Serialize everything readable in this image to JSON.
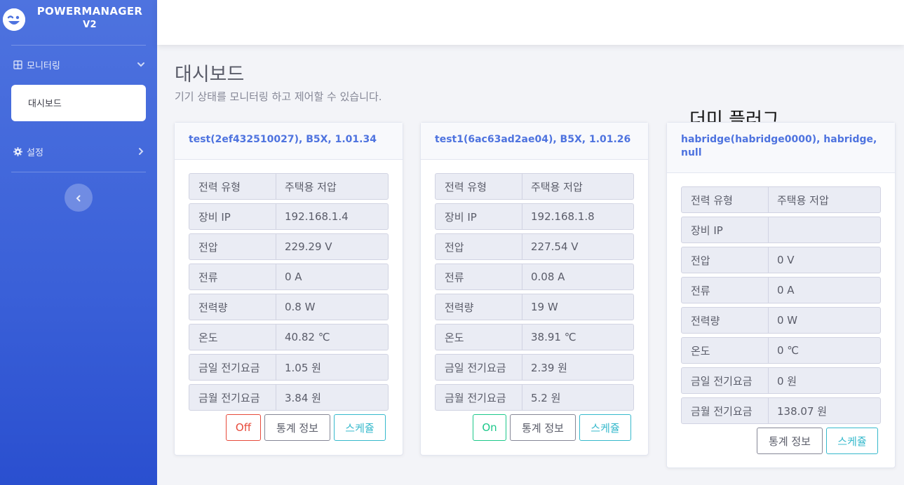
{
  "brand": {
    "name_line1": "POWERMANAGER",
    "name_line2": "V2"
  },
  "sidebar": {
    "menu_monitoring": "모니터링",
    "submenu_dashboard": "대시보드",
    "menu_settings": "설정"
  },
  "page": {
    "title": "대시보드",
    "subtitle": "기기 상태를 모니터링 하고 제어할 수 있습니다.",
    "dummy_label": "더미 플러그"
  },
  "labels": {
    "power_type": "전력 유형",
    "device_ip": "장비 IP",
    "voltage": "전압",
    "current": "전류",
    "power": "전력량",
    "temperature": "온도",
    "today_fee": "금일 전기요금",
    "month_fee": "금월 전기요금",
    "btn_stats": "통계 정보",
    "btn_schedule": "스케쥴"
  },
  "devices": [
    {
      "header": "test(2ef432510027), B5X, 1.01.34",
      "power_type": "주택용 저압",
      "device_ip": "192.168.1.4",
      "voltage": "229.29 V",
      "current": "0 A",
      "power": "0.8 W",
      "temperature": "40.82 ℃",
      "today_fee": "1.05 원",
      "month_fee": "3.84 원",
      "switch_label": "Off"
    },
    {
      "header": "test1(6ac63ad2ae04), B5X, 1.01.26",
      "power_type": "주택용 저압",
      "device_ip": "192.168.1.8",
      "voltage": "227.54 V",
      "current": "0.08 A",
      "power": "19 W",
      "temperature": "38.91 ℃",
      "today_fee": "2.39 원",
      "month_fee": "5.2 원",
      "switch_label": "On"
    },
    {
      "header": "habridge(habridge0000), habridge, null",
      "power_type": "주택용 저압",
      "device_ip": "",
      "voltage": "0 V",
      "current": "0 A",
      "power": "0 W",
      "temperature": "0 ℃",
      "today_fee": "0 원",
      "month_fee": "138.07 원"
    }
  ],
  "colors": {
    "primary": "#4e73df",
    "danger": "#e74a3b",
    "success": "#1cc88a",
    "info": "#36b9cc",
    "secondary": "#858796"
  },
  "icons": {
    "brand": "laugh-wink-icon",
    "monitoring": "grid-icon",
    "settings": "cog-icon",
    "expand": "chevron-down-icon",
    "collapse": "chevron-right-icon",
    "sidebar_toggle": "chevron-left-icon"
  }
}
